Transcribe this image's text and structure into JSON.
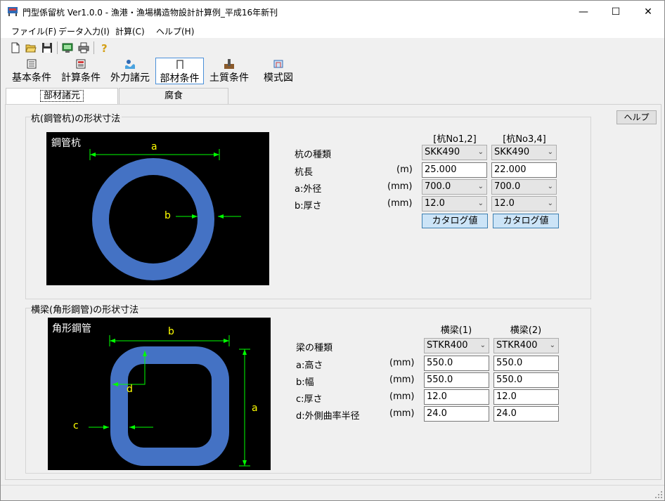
{
  "window": {
    "title": "門型係留杭 Ver1.0.0 - 漁港・漁場構造物設計計算例_平成16年新刊",
    "minimize_glyph": "—",
    "maximize_glyph": "☐",
    "close_glyph": "✕"
  },
  "menu": [
    {
      "label": "ファイル(F)"
    },
    {
      "label": "データ入力(I)"
    },
    {
      "label": "計算(C)"
    },
    {
      "label": "ヘルプ(H)"
    }
  ],
  "toolbar_icons": [
    "new-file-icon",
    "open-folder-icon",
    "save-icon",
    "calculate-icon",
    "print-icon",
    "help-icon"
  ],
  "toolbar2": [
    {
      "label": "基本条件",
      "icon": "basic-conditions-icon"
    },
    {
      "label": "計算条件",
      "icon": "calc-conditions-icon"
    },
    {
      "label": "外力諸元",
      "icon": "external-force-icon"
    },
    {
      "label": "部材条件",
      "icon": "member-conditions-icon",
      "active": true
    },
    {
      "label": "土質条件",
      "icon": "soil-conditions-icon"
    },
    {
      "label": "模式図",
      "icon": "schematic-icon"
    }
  ],
  "tabs": [
    {
      "label": "部材諸元",
      "selected": true
    },
    {
      "label": "腐食",
      "selected": false
    }
  ],
  "help_button": "ヘルプ",
  "pile": {
    "group_title": "杭(鋼管杭)の形状寸法",
    "canvas_label": "鋼管杭",
    "dim_a": "a",
    "dim_b": "b",
    "headers": [
      "[杭No1,2]",
      "[杭No3,4]"
    ],
    "rows": [
      {
        "label": "杭の種類",
        "unit": "",
        "type": "select",
        "values": [
          "SKK490",
          "SKK490"
        ]
      },
      {
        "label": "杭長",
        "unit": "(m)",
        "type": "input",
        "values": [
          "25.000",
          "22.000"
        ]
      },
      {
        "label": "a:外径",
        "unit": "(mm)",
        "type": "select",
        "values": [
          "700.0",
          "700.0"
        ]
      },
      {
        "label": "b:厚さ",
        "unit": "(mm)",
        "type": "select",
        "values": [
          "12.0",
          "12.0"
        ]
      }
    ],
    "catalog_button": "カタログ値"
  },
  "beam": {
    "group_title": "横梁(角形鋼管)の形状寸法",
    "canvas_label": "角形鋼管",
    "dim_a": "a",
    "dim_b": "b",
    "dim_c": "c",
    "dim_d": "d",
    "headers": [
      "横梁(1)",
      "横梁(2)"
    ],
    "rows": [
      {
        "label": "梁の種類",
        "unit": "",
        "type": "select",
        "values": [
          "STKR400",
          "STKR400"
        ]
      },
      {
        "label": "a:高さ",
        "unit": "(mm)",
        "type": "input",
        "values": [
          "550.0",
          "550.0"
        ]
      },
      {
        "label": "b:幅",
        "unit": "(mm)",
        "type": "input",
        "values": [
          "550.0",
          "550.0"
        ]
      },
      {
        "label": "c:厚さ",
        "unit": "(mm)",
        "type": "input",
        "values": [
          "12.0",
          "12.0"
        ]
      },
      {
        "label": "d:外側曲率半径",
        "unit": "(mm)",
        "type": "input",
        "values": [
          "24.0",
          "24.0"
        ]
      }
    ]
  },
  "colors": {
    "steel_blue": "#4472c4",
    "dim_green": "#00ff00",
    "dim_yellow": "#ffff00"
  }
}
